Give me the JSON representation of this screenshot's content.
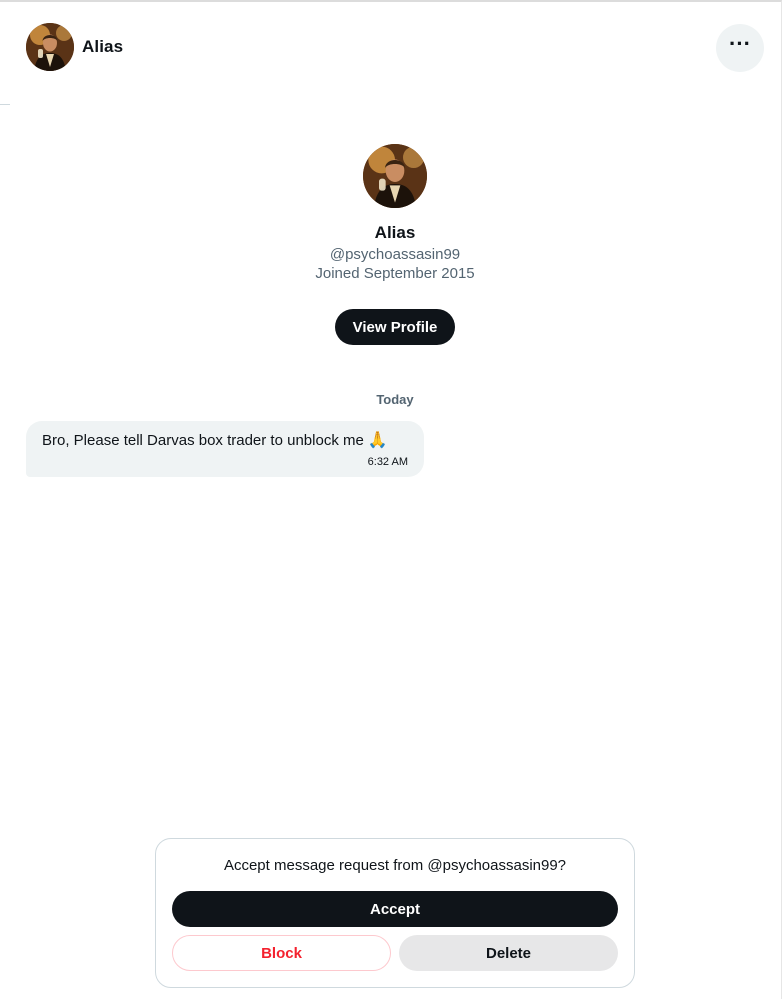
{
  "header": {
    "name": "Alias",
    "more_icon": "more-horizontal-icon",
    "more_label": "···"
  },
  "profile": {
    "name": "Alias",
    "handle": "@psychoassasin99",
    "joined": "Joined September 2015",
    "view_profile_label": "View Profile"
  },
  "conversation": {
    "date_separator": "Today",
    "messages": [
      {
        "text": "Bro, Please tell Darvas box trader to unblock me",
        "emoji": "🙏",
        "time": "6:32 AM"
      }
    ]
  },
  "request": {
    "prompt": "Accept message request from @psychoassasin99?",
    "accept_label": "Accept",
    "block_label": "Block",
    "delete_label": "Delete"
  },
  "colors": {
    "primary_button": "#0f1419",
    "bubble_bg": "#eff3f4",
    "danger": "#f4212e",
    "secondary_text": "#536471"
  }
}
